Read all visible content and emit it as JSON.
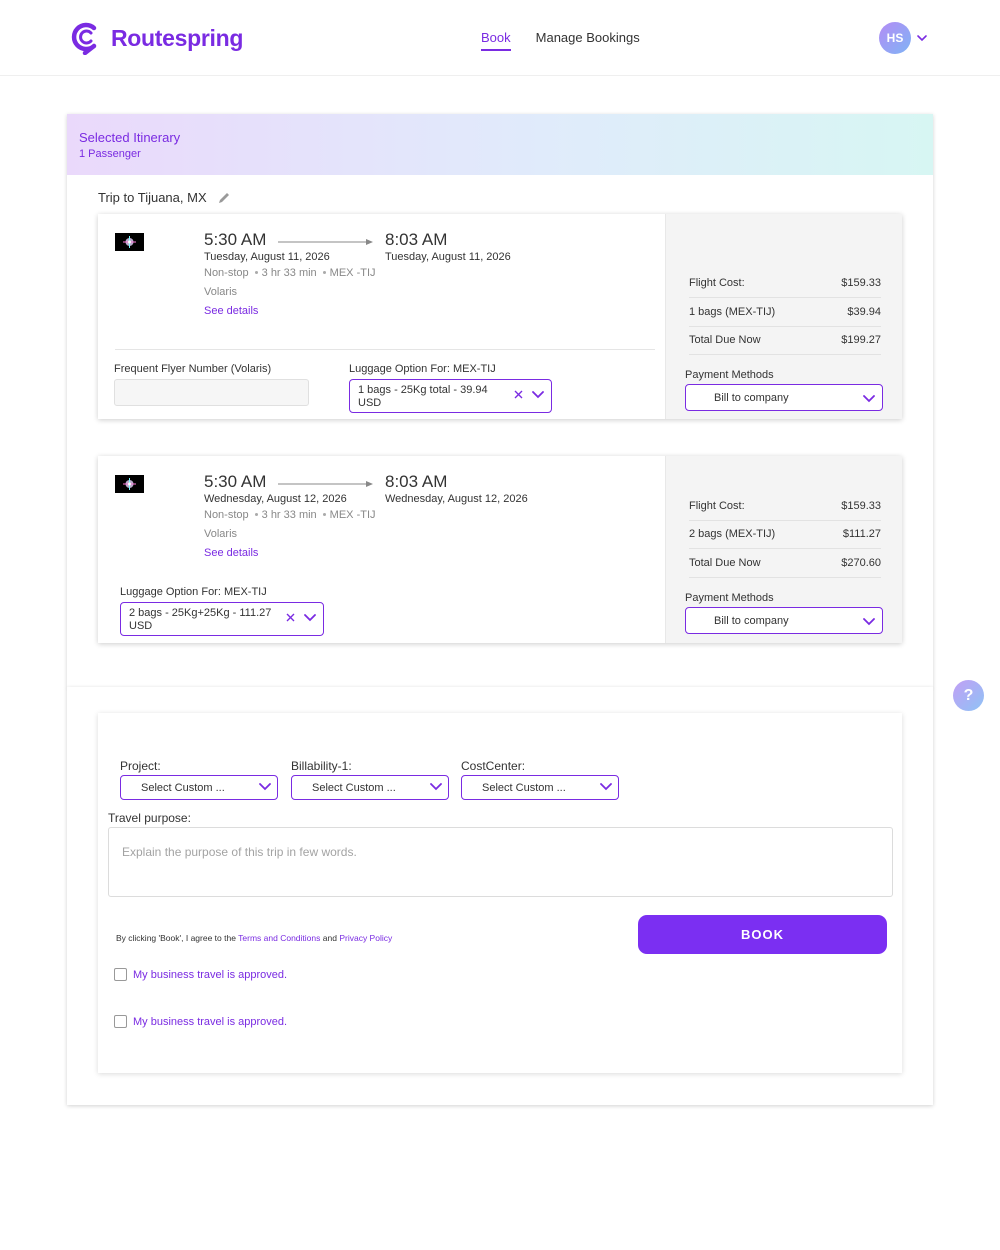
{
  "app": {
    "brand": "Routespring"
  },
  "nav": {
    "items": [
      {
        "label": "Book",
        "active": true
      },
      {
        "label": "Manage Bookings",
        "active": false
      }
    ]
  },
  "user": {
    "initials": "HS"
  },
  "itinerary": {
    "title": "Selected Itinerary",
    "passengers": "1 Passenger",
    "trip_title": "Trip to Tijuana, MX",
    "flights": [
      {
        "depart_time": "5:30 AM",
        "arrive_time": "8:03 AM",
        "depart_date": "Tuesday, August 11, 2026",
        "arrive_date": "Tuesday, August 11, 2026",
        "stops": "Non-stop",
        "duration": "3 hr 33 min",
        "route": "MEX -TIJ",
        "airline": "Volaris",
        "details_link": "See details",
        "frequent_flyer_label": "Frequent Flyer Number (Volaris)",
        "frequent_flyer_value": "",
        "luggage_label": "Luggage Option For: MEX-TIJ",
        "luggage_value": "1 bags - 25Kg total - 39.94 USD",
        "prices": [
          {
            "label": "Flight Cost:",
            "amount": "$159.33"
          },
          {
            "label": "1 bags (MEX-TIJ)",
            "amount": "$39.94"
          },
          {
            "label": "Total Due Now",
            "amount": "$199.27"
          }
        ],
        "payment_label": "Payment Methods",
        "payment_value": "Bill to company"
      },
      {
        "depart_time": "5:30 AM",
        "arrive_time": "8:03 AM",
        "depart_date": "Wednesday, August 12, 2026",
        "arrive_date": "Wednesday, August 12, 2026",
        "stops": "Non-stop",
        "duration": "3 hr 33 min",
        "route": "MEX -TIJ",
        "airline": "Volaris",
        "details_link": "See details",
        "luggage_label": "Luggage Option For: MEX-TIJ",
        "luggage_value": "2 bags - 25Kg+25Kg - 111.27 USD",
        "prices": [
          {
            "label": "Flight Cost:",
            "amount": "$159.33"
          },
          {
            "label": "2 bags (MEX-TIJ)",
            "amount": "$111.27"
          },
          {
            "label": "Total Due Now",
            "amount": "$270.60"
          }
        ],
        "payment_label": "Payment Methods",
        "payment_value": "Bill to company"
      }
    ]
  },
  "custom_fields": [
    {
      "label": "Project:",
      "value": "Select Custom ..."
    },
    {
      "label": "Billability-1:",
      "value": "Select Custom ..."
    },
    {
      "label": "CostCenter:",
      "value": "Select Custom ..."
    }
  ],
  "purpose": {
    "label": "Travel purpose:",
    "placeholder": "Explain the purpose of this trip in few words."
  },
  "terms": {
    "prefix": "By clicking 'Book', I agree to the",
    "terms_link": "Terms and Conditions",
    "and": "and",
    "privacy_link": "Privacy Policy"
  },
  "book_button": "BOOK",
  "approvals": [
    {
      "label": "My business travel is approved."
    },
    {
      "label": "My business travel is approved."
    }
  ],
  "help": {
    "label": "?"
  },
  "colors": {
    "accent": "#7a2be2",
    "button": "#7b2ff2"
  }
}
